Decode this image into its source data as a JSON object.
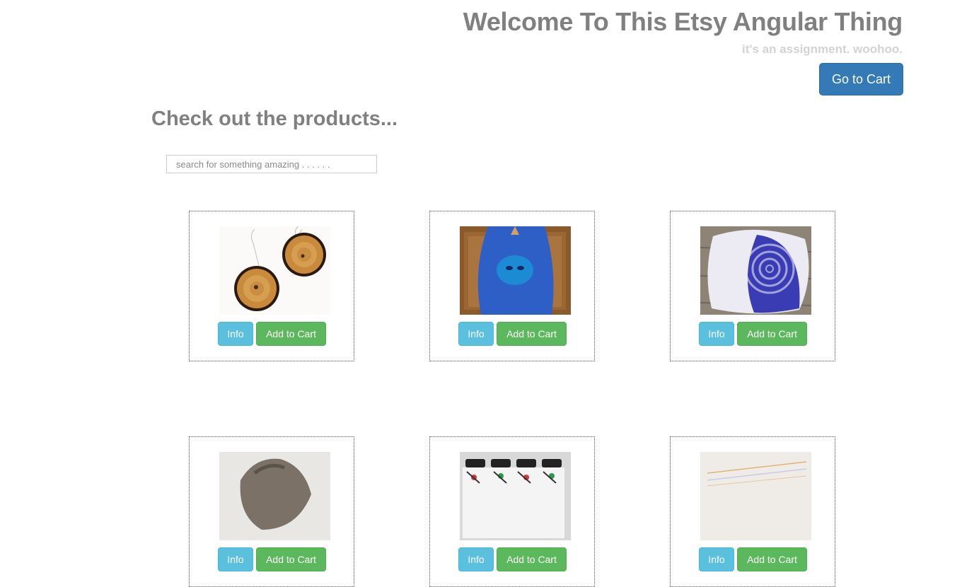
{
  "header": {
    "title": "Welcome To This Etsy Angular Thing",
    "subtitle": "it's an assignment. woohoo.",
    "cart_button": "Go to Cart"
  },
  "main": {
    "heading": "Check out the products...",
    "search_placeholder": "search for something amazing . . . . . ."
  },
  "products": [
    {
      "image": "wood-slice-earrings",
      "info_label": "Info",
      "cart_label": "Add to Cart"
    },
    {
      "image": "blue-tote-bag",
      "info_label": "Info",
      "cart_label": "Add to Cart"
    },
    {
      "image": "blue-swirl-pottery-dish",
      "info_label": "Info",
      "cart_label": "Add to Cart"
    },
    {
      "image": "stone-sculpture",
      "info_label": "Info",
      "cart_label": "Add to Cart"
    },
    {
      "image": "patterned-water-bottles",
      "info_label": "Info",
      "cart_label": "Add to Cart"
    },
    {
      "image": "speckled-ceramic",
      "info_label": "Info",
      "cart_label": "Add to Cart"
    }
  ],
  "colors": {
    "primary": "#337ab7",
    "info": "#5bc0de",
    "success": "#5cb85c",
    "heading": "#808080",
    "subtitle": "#d3d3d3"
  }
}
